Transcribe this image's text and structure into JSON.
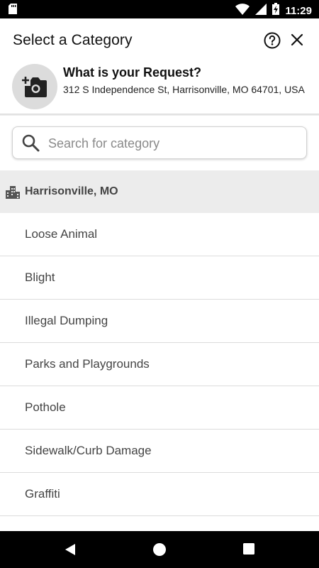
{
  "status_bar": {
    "time": "11:29"
  },
  "header": {
    "title": "Select a Category"
  },
  "request": {
    "title": "What is your Request?",
    "address": "312 S Independence St, Harrisonville, MO 64701, USA"
  },
  "search": {
    "placeholder": "Search for category",
    "value": ""
  },
  "section": {
    "label": "Harrisonville, MO"
  },
  "categories": [
    {
      "label": "Loose Animal"
    },
    {
      "label": "Blight"
    },
    {
      "label": "Illegal Dumping"
    },
    {
      "label": "Parks and Playgrounds"
    },
    {
      "label": "Pothole"
    },
    {
      "label": "Sidewalk/Curb Damage"
    },
    {
      "label": "Graffiti"
    }
  ],
  "icons": {
    "status_left": "sd-card-icon",
    "wifi": "wifi-icon",
    "signal": "signal-icon",
    "battery": "battery-charging-icon",
    "help": "help-circle-icon",
    "close": "close-icon",
    "camera": "add-photo-icon",
    "search": "search-icon",
    "city": "city-icon",
    "nav_back": "back-icon",
    "nav_home": "home-icon",
    "nav_recents": "recents-icon"
  },
  "colors": {
    "section_bg": "#ececec",
    "avatar_bg": "#dcdcdc",
    "status_bar_bg": "#000000",
    "text_muted": "#444444"
  }
}
